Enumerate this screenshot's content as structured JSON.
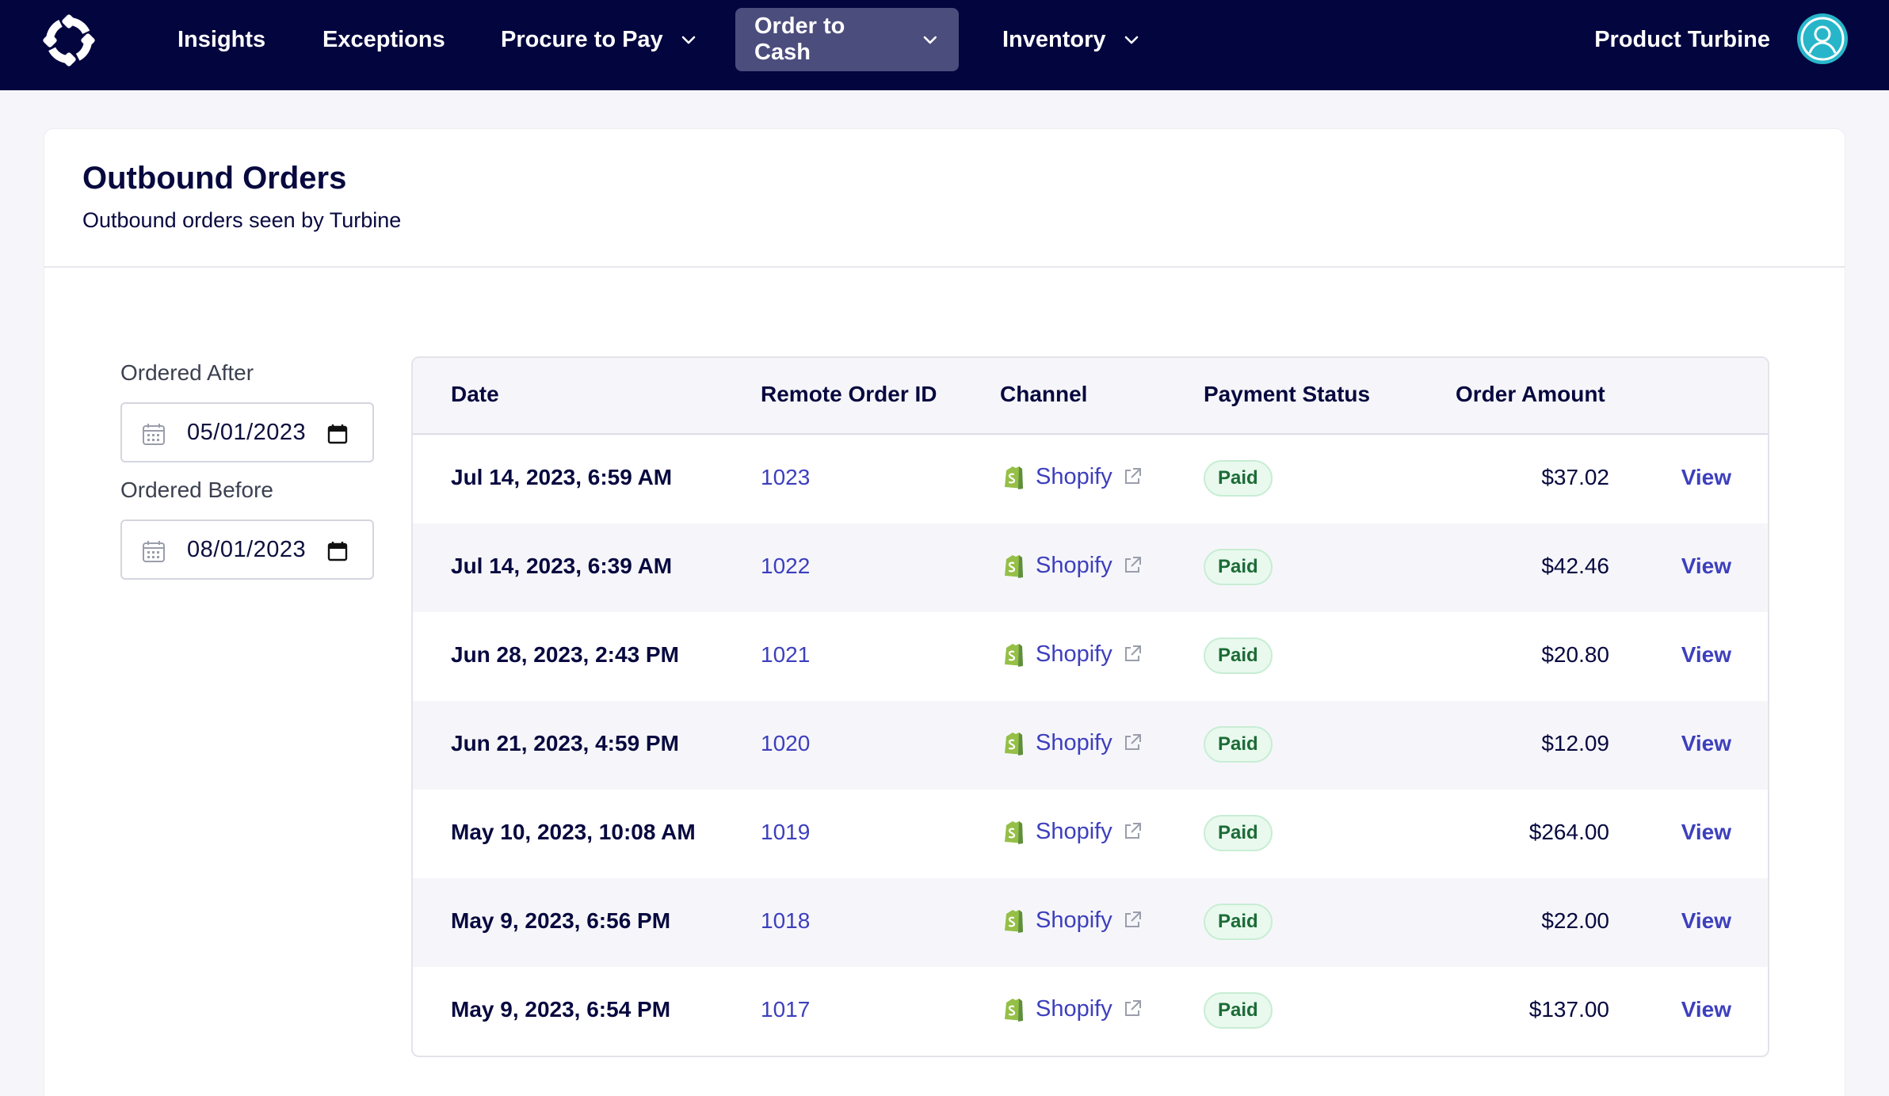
{
  "nav": {
    "items": [
      {
        "label": "Insights"
      },
      {
        "label": "Exceptions"
      },
      {
        "label": "Procure to Pay"
      },
      {
        "label": "Order to Cash"
      },
      {
        "label": "Inventory"
      }
    ],
    "user_name": "Product Turbine",
    "accent": "#03053f",
    "active_bg": "#4b4d7d"
  },
  "page": {
    "title": "Outbound Orders",
    "subtitle": "Outbound orders seen by Turbine"
  },
  "filters": {
    "ordered_after_label": "Ordered After",
    "ordered_after_value": "05/01/2023",
    "ordered_before_label": "Ordered Before",
    "ordered_before_value": "08/01/2023"
  },
  "table": {
    "headers": {
      "date": "Date",
      "remote_order_id": "Remote Order ID",
      "channel": "Channel",
      "payment_status": "Payment Status",
      "order_amount": "Order Amount"
    },
    "rows": [
      {
        "date": "Jul 14, 2023, 6:59 AM",
        "id": "1023",
        "channel": "Shopify",
        "status": "Paid",
        "amount": "$37.02",
        "action": "View"
      },
      {
        "date": "Jul 14, 2023, 6:39 AM",
        "id": "1022",
        "channel": "Shopify",
        "status": "Paid",
        "amount": "$42.46",
        "action": "View"
      },
      {
        "date": "Jun 28, 2023, 2:43 PM",
        "id": "1021",
        "channel": "Shopify",
        "status": "Paid",
        "amount": "$20.80",
        "action": "View"
      },
      {
        "date": "Jun 21, 2023, 4:59 PM",
        "id": "1020",
        "channel": "Shopify",
        "status": "Paid",
        "amount": "$12.09",
        "action": "View"
      },
      {
        "date": "May 10, 2023, 10:08 AM",
        "id": "1019",
        "channel": "Shopify",
        "status": "Paid",
        "amount": "$264.00",
        "action": "View"
      },
      {
        "date": "May 9, 2023, 6:56 PM",
        "id": "1018",
        "channel": "Shopify",
        "status": "Paid",
        "amount": "$22.00",
        "action": "View"
      },
      {
        "date": "May 9, 2023, 6:54 PM",
        "id": "1017",
        "channel": "Shopify",
        "status": "Paid",
        "amount": "$137.00",
        "action": "View"
      }
    ]
  }
}
